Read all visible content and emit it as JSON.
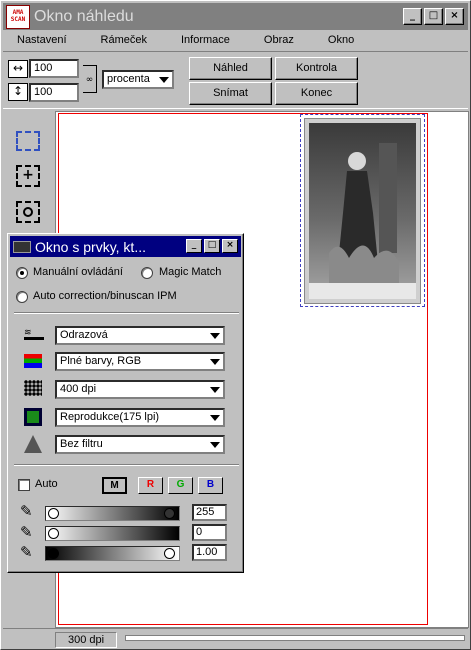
{
  "window": {
    "title": "Okno náhledu",
    "logo_text": "AMA SCAN"
  },
  "window_buttons": [
    "_",
    "□",
    "×"
  ],
  "menu": [
    "Nastavení",
    "Rámeček",
    "Informace",
    "Obraz",
    "Okno"
  ],
  "toolbar": {
    "width_value": "100",
    "height_value": "100",
    "unit": "procenta",
    "buttons": {
      "preview": "Náhled",
      "check": "Kontrola",
      "scan": "Snímat",
      "end": "Konec"
    }
  },
  "tools": [
    "select-rect-icon",
    "zoom-frame-icon",
    "zoom-rect-icon"
  ],
  "status": {
    "dpi": "300 dpi"
  },
  "palette": {
    "title": "Okno s prvky, kt...",
    "radios": {
      "manual": "Manuální ovládání",
      "magic": "Magic Match",
      "auto": "Auto correction/binuscan IPM"
    },
    "selects": {
      "source": "Odrazová",
      "color": "Plné barvy, RGB",
      "resolution": "400 dpi",
      "screen": "Reprodukce(175 lpi)",
      "filter": "Bez filtru"
    },
    "auto_label": "Auto",
    "channels": [
      "M",
      "R",
      "G",
      "B"
    ],
    "levels": {
      "white": "255",
      "black": "0",
      "gamma": "1.00"
    }
  },
  "colors": {
    "title_active": "#000080",
    "title_inactive": "#808080",
    "frame": "#e00000",
    "selection": "#4040c0"
  }
}
